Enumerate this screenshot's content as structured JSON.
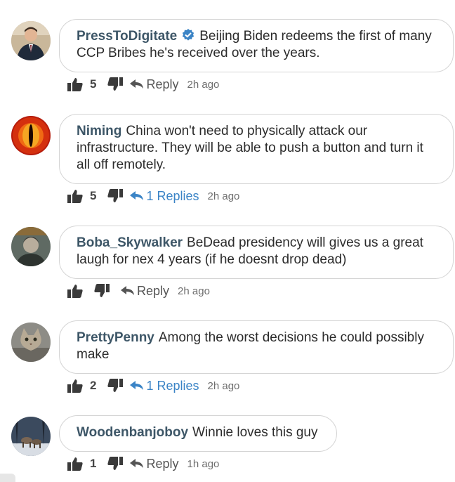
{
  "comments": [
    {
      "author": "PressToDigitate",
      "verified": true,
      "text": "Beijing Biden redeems the first of many CCP Bribes he's received over the years.",
      "likes": "5",
      "reply_label": "Reply",
      "time": "2h ago",
      "avatar": "man-in-suit-avatar"
    },
    {
      "author": "Niming",
      "verified": false,
      "text": "China won't need to physically attack our infrastructure. They will be able to push a button and turn it all off remotely.",
      "likes": "5",
      "reply_label": "1 Replies",
      "time": "2h ago",
      "avatar": "eye-of-sauron-avatar"
    },
    {
      "author": "Boba_Skywalker",
      "verified": false,
      "text": "BeDead presidency will gives us a great laugh for nex 4 years (if he doesnt drop dead)",
      "likes": "",
      "reply_label": "Reply",
      "time": "2h ago",
      "avatar": "portrait-avatar"
    },
    {
      "author": "PrettyPenny",
      "verified": false,
      "text": "Among the worst decisions he could possibly make",
      "likes": "2",
      "reply_label": "1 Replies",
      "time": "2h ago",
      "avatar": "cat-avatar"
    },
    {
      "author": "Woodenbanjoboy",
      "verified": false,
      "text": "Winnie loves this guy",
      "likes": "1",
      "reply_label": "Reply",
      "time": "1h ago",
      "avatar": "deer-avatar"
    }
  ],
  "colors": {
    "author": "#3d5667",
    "reply_link": "#3b84c6",
    "verified_badge": "#3b84c6",
    "icon": "#3a3a3a"
  }
}
